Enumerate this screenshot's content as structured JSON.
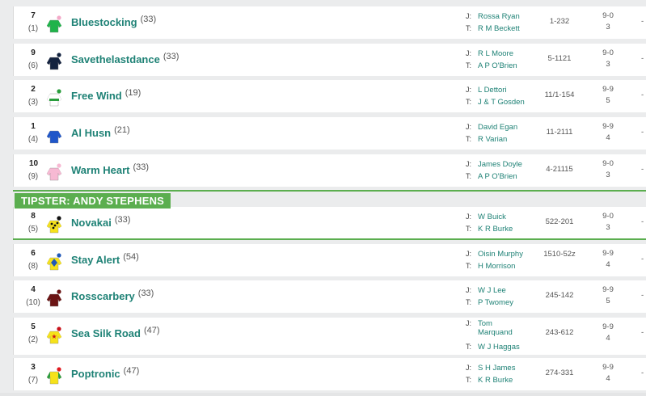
{
  "tipster": {
    "label": "TIPSTER: ANDY STEPHENS"
  },
  "labels": {
    "jockey": "J:",
    "trainer": "T:"
  },
  "runners": [
    {
      "number": "7",
      "draw": "(1)",
      "name": "Bluestocking",
      "age": "(33)",
      "jockey": "Rossa Ryan",
      "trainer": "R M Beckett",
      "form": "1-232",
      "weight": "9-0",
      "or": "3",
      "odds": "-",
      "silk": "green-pink",
      "silk_colors": [
        "#1fb34a",
        "#f3a9c8"
      ]
    },
    {
      "number": "9",
      "draw": "(6)",
      "name": "Savethelastdance",
      "age": "(33)",
      "jockey": "R L Moore",
      "trainer": "A P O'Brien",
      "form": "5-1121",
      "weight": "9-0",
      "or": "3",
      "odds": "-",
      "silk": "navy",
      "silk_colors": [
        "#13223f",
        "#13223f"
      ]
    },
    {
      "number": "2",
      "draw": "(3)",
      "name": "Free Wind",
      "age": "(19)",
      "jockey": "L Dettori",
      "trainer": "J & T Gosden",
      "form": "11/1-154",
      "weight": "9-9",
      "or": "5",
      "odds": "-",
      "silk": "white-green",
      "silk_colors": [
        "#ffffff",
        "#2a9d3d"
      ]
    },
    {
      "number": "1",
      "draw": "(4)",
      "name": "Al Husn",
      "age": "(21)",
      "jockey": "David Egan",
      "trainer": "R Varian",
      "form": "11-2111",
      "weight": "9-9",
      "or": "4",
      "odds": "-",
      "silk": "royal-blue",
      "silk_colors": [
        "#1f56c9",
        "#ffffff"
      ]
    },
    {
      "number": "10",
      "draw": "(9)",
      "name": "Warm Heart",
      "age": "(33)",
      "jockey": "James Doyle",
      "trainer": "A P O'Brien",
      "form": "4-21115",
      "weight": "9-0",
      "or": "3",
      "odds": "-",
      "silk": "pink",
      "silk_colors": [
        "#f7b9d3",
        "#f7b9d3"
      ]
    },
    {
      "number": "8",
      "draw": "(5)",
      "name": "Novakai",
      "age": "(33)",
      "jockey": "W Buick",
      "trainer": "K R Burke",
      "form": "522-201",
      "weight": "9-0",
      "or": "3",
      "odds": "-",
      "silk": "yellow-black",
      "silk_colors": [
        "#f6e21a",
        "#111111"
      ]
    },
    {
      "number": "6",
      "draw": "(8)",
      "name": "Stay Alert",
      "age": "(54)",
      "jockey": "Oisin Murphy",
      "trainer": "H Morrison",
      "form": "1510-52z",
      "weight": "9-9",
      "or": "4",
      "odds": "-",
      "silk": "yellow-blue",
      "silk_colors": [
        "#f6e21a",
        "#2058b8"
      ]
    },
    {
      "number": "4",
      "draw": "(10)",
      "name": "Rosscarbery",
      "age": "(33)",
      "jockey": "W J Lee",
      "trainer": "P Twomey",
      "form": "245-142",
      "weight": "9-9",
      "or": "5",
      "odds": "-",
      "silk": "maroon",
      "silk_colors": [
        "#6b1414",
        "#6b1414"
      ]
    },
    {
      "number": "5",
      "draw": "(2)",
      "name": "Sea Silk Road",
      "age": "(47)",
      "jockey": "Tom Marquand",
      "trainer": "W J Haggas",
      "form": "243-612",
      "weight": "9-9",
      "or": "4",
      "odds": "-",
      "silk": "yellow-star",
      "silk_colors": [
        "#f6e21a",
        "#c9131b"
      ]
    },
    {
      "number": "3",
      "draw": "(7)",
      "name": "Poptronic",
      "age": "(47)",
      "jockey": "S H James",
      "trainer": "K R Burke",
      "form": "274-331",
      "weight": "9-9",
      "or": "4",
      "odds": "-",
      "silk": "yellow-red",
      "silk_colors": [
        "#f6e21a",
        "#e0191f"
      ]
    }
  ]
}
